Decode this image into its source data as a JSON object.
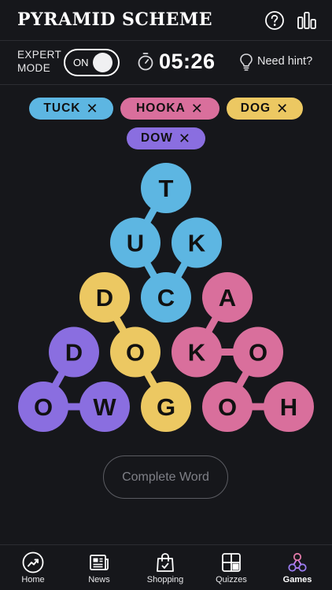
{
  "header": {
    "title": "PYRAMID SCHEME"
  },
  "controls": {
    "expert_mode_label": "EXPERT MODE",
    "toggle_label": "ON",
    "timer": "05:26",
    "hint_label": "Need hint?"
  },
  "found_words": [
    {
      "word": "TUCK",
      "color": "#5db6e2"
    },
    {
      "word": "HOOKA",
      "color": "#d96f9c"
    },
    {
      "word": "DOG",
      "color": "#ecc862"
    },
    {
      "word": "DOW",
      "color": "#8a6ee0"
    }
  ],
  "remove_symbol": "✕",
  "colors": {
    "blue": "#5db6e2",
    "pink": "#d96f9c",
    "yellow": "#ecc862",
    "purple": "#8a6ee0",
    "background": "#16171b"
  },
  "pyramid": {
    "rows": [
      [
        "T"
      ],
      [
        "U",
        "K"
      ],
      [
        "D",
        "C",
        "A"
      ],
      [
        "D",
        "O",
        "K",
        "O"
      ],
      [
        "O",
        "W",
        "G",
        "O",
        "H"
      ]
    ],
    "colors": [
      [
        "blue"
      ],
      [
        "blue",
        "blue"
      ],
      [
        "yellow",
        "blue",
        "pink"
      ],
      [
        "purple",
        "yellow",
        "pink",
        "pink"
      ],
      [
        "purple",
        "purple",
        "yellow",
        "pink",
        "pink"
      ]
    ],
    "paths": [
      {
        "word": "TUCK",
        "color": "blue",
        "cells": [
          [
            0,
            0
          ],
          [
            1,
            0
          ],
          [
            2,
            1
          ],
          [
            1,
            1
          ]
        ]
      },
      {
        "word": "HOOKA",
        "color": "pink",
        "cells": [
          [
            4,
            4
          ],
          [
            4,
            3
          ],
          [
            3,
            3
          ],
          [
            3,
            2
          ],
          [
            2,
            2
          ]
        ]
      },
      {
        "word": "DOG",
        "color": "yellow",
        "cells": [
          [
            2,
            0
          ],
          [
            3,
            1
          ],
          [
            4,
            2
          ]
        ]
      },
      {
        "word": "DOW",
        "color": "purple",
        "cells": [
          [
            3,
            0
          ],
          [
            4,
            0
          ],
          [
            4,
            1
          ]
        ]
      }
    ]
  },
  "complete_button": "Complete Word",
  "tabs": [
    {
      "label": "Home",
      "icon": "home-icon"
    },
    {
      "label": "News",
      "icon": "news-icon"
    },
    {
      "label": "Shopping",
      "icon": "shopping-icon"
    },
    {
      "label": "Quizzes",
      "icon": "quizzes-icon"
    },
    {
      "label": "Games",
      "icon": "games-icon",
      "active": true
    }
  ]
}
